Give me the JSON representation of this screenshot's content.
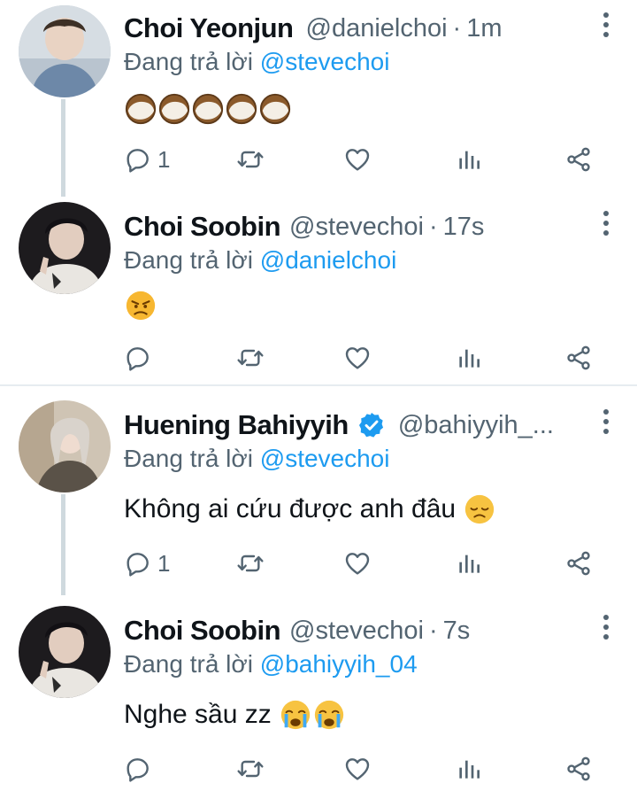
{
  "tweets": [
    {
      "name": "Choi Yeonjun",
      "handle": "@danielchoi",
      "time": "1m",
      "replying_prefix": "Đang trả lời",
      "replying_to": "@stevechoi",
      "text": "",
      "emojis": [
        "coconut",
        "coconut",
        "coconut",
        "coconut",
        "coconut"
      ],
      "reply_count": "1",
      "verified": false
    },
    {
      "name": "Choi Soobin",
      "handle": "@stevechoi",
      "time": "17s",
      "replying_prefix": "Đang trả lời",
      "replying_to": "@danielchoi",
      "text": "",
      "emojis": [
        "angry-face"
      ],
      "reply_count": "",
      "verified": false
    },
    {
      "name": "Huening Bahiyyih",
      "handle": "@bahiyyih_...",
      "time": "",
      "replying_prefix": "Đang trả lời",
      "replying_to": "@stevechoi",
      "text": "Không ai cứu được anh đâu",
      "emojis": [
        "disappointed-face"
      ],
      "reply_count": "1",
      "verified": true
    },
    {
      "name": "Choi Soobin",
      "handle": "@stevechoi",
      "time": "7s",
      "replying_prefix": "Đang trả lời",
      "replying_to": "@bahiyyih_04",
      "text": "Nghe sầu zz",
      "emojis": [
        "loudly-crying-face",
        "loudly-crying-face"
      ],
      "reply_count": "",
      "verified": false
    }
  ],
  "colors": {
    "text": "#0f1419",
    "secondary": "#536471",
    "accent": "#1d9bf0",
    "thread_line": "#cfd9de",
    "divider": "#e6ecf0"
  }
}
